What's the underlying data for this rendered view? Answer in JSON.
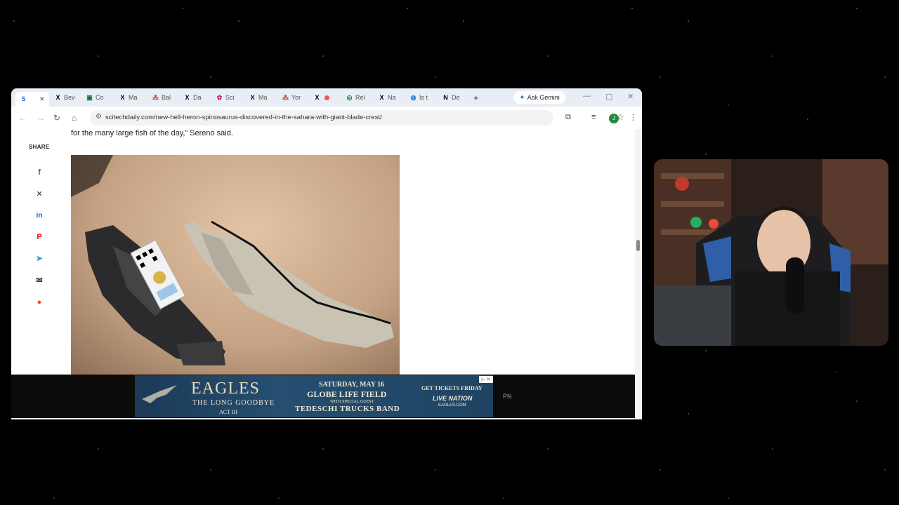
{
  "browser": {
    "tabs": [
      {
        "icon": "S",
        "label": "",
        "active": true
      },
      {
        "icon": "X",
        "label": "Bev"
      },
      {
        "icon": "▣",
        "label": "Co"
      },
      {
        "icon": "X",
        "label": "Ma"
      },
      {
        "icon": "⁂",
        "label": "Bal"
      },
      {
        "icon": "X",
        "label": "Da"
      },
      {
        "icon": "✿",
        "label": "Sci"
      },
      {
        "icon": "X",
        "label": "Ma"
      },
      {
        "icon": "⁂",
        "label": "Yor"
      },
      {
        "icon": "X",
        "label": ""
      },
      {
        "icon": "◎",
        "label": "Rel"
      },
      {
        "icon": "X",
        "label": "Na"
      },
      {
        "icon": "◍",
        "label": "Is t"
      },
      {
        "icon": "N",
        "label": "De"
      }
    ],
    "new_tab": "+",
    "gemini_label": "Ask Gemini",
    "url": "scitechdaily.com/new-hell-heron-spinosaurus-discovered-in-the-sahara-with-giant-blade-crest/",
    "avatar_letter": "J"
  },
  "article": {
    "lead_text": "for the many large fish of the day,” Sereno said.",
    "share_label": "SHARE",
    "share_icons": [
      "facebook-icon",
      "x-icon",
      "linkedin-icon",
      "pinterest-icon",
      "telegram-icon",
      "email-icon",
      "reddit-icon"
    ]
  },
  "ad": {
    "title": "EAGLES",
    "subtitle": "THE LONG GOODBYE",
    "act": "ACT III",
    "date": "SATURDAY, MAY 16",
    "venue": "GLOBE LIFE FIELD",
    "with_special_guest": "WITH SPECIAL GUEST",
    "band": "TEDESCHI TRUCKS BAND",
    "cta": "GET TICKETS FRIDAY",
    "live_nation": "LIVE NATION",
    "site": "EAGLES.COM",
    "side_text": "PN"
  },
  "colors": {
    "background": "#000000",
    "ad_blue": "#1f4463",
    "avatar_green": "#1e8e3e"
  }
}
